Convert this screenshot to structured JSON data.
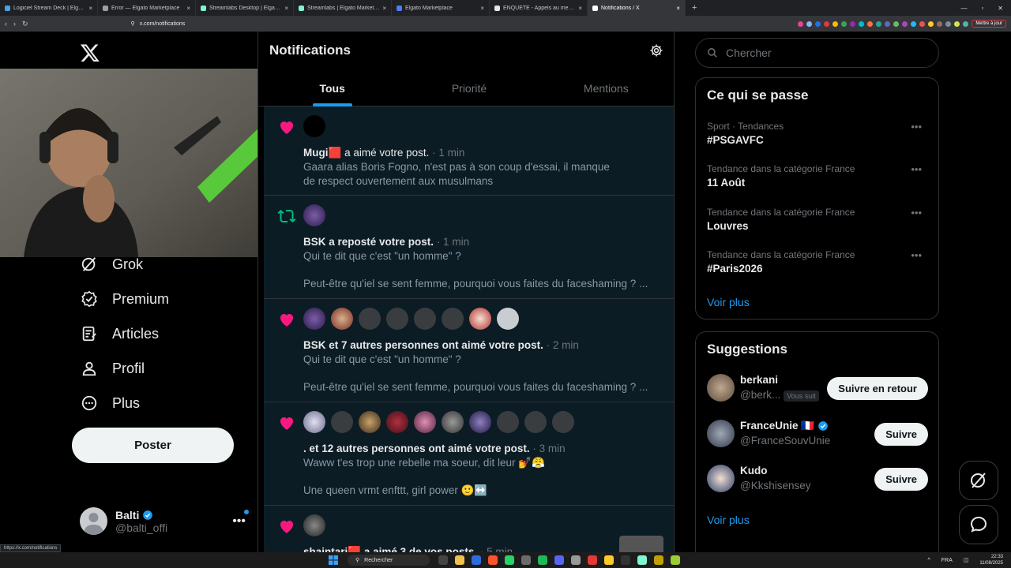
{
  "browser": {
    "tabs": [
      {
        "title": "Logiciel Stream Deck | Elgato",
        "color": "#4aa3df"
      },
      {
        "title": "Error — Elgato Marketplace",
        "color": "#9aa0a6"
      },
      {
        "title": "Streamlabs Desktop | Elgato Marketp",
        "color": "#80f5d2"
      },
      {
        "title": "Streamlabs | Elgato Marketplace",
        "color": "#80f5d2"
      },
      {
        "title": "Elgato Marketplace",
        "color": "#4d7cfe"
      },
      {
        "title": "ENQUÊTE - Appels au meurtre, raton",
        "color": "#e6e6e6"
      },
      {
        "title": "Notifications / X",
        "color": "#ffffff"
      }
    ],
    "new_tab": "+",
    "url": "x.com/notifications",
    "ext_button": "Mettre à jour",
    "status_url": "https://x.com/notifications"
  },
  "nav": {
    "items": [
      {
        "label": "Grok",
        "icon": "grok-icon"
      },
      {
        "label": "Premium",
        "icon": "premium-icon"
      },
      {
        "label": "Articles",
        "icon": "articles-icon"
      },
      {
        "label": "Profil",
        "icon": "profile-icon"
      },
      {
        "label": "Plus",
        "icon": "more-circle-icon"
      }
    ],
    "post_button": "Poster",
    "account": {
      "name": "Balti",
      "handle": "@balti_offi"
    }
  },
  "main": {
    "title": "Notifications",
    "tabs": [
      "Tous",
      "Priorité",
      "Mentions"
    ],
    "notifications": [
      {
        "type": "like",
        "user": "Mugi🟥",
        "action": " a aimé votre post.",
        "time": " · 1 min",
        "body1": "Gaara alias Boris Fogno, n'est pas à son coup d'essai, il manque",
        "body2": "de respect ouvertement aux musulmans",
        "body3": ""
      },
      {
        "type": "repost",
        "user": "BSK",
        "action": " a reposté votre post.",
        "time": " · 1 min",
        "body1": "Qui te dit que c'est \"un homme\" ?",
        "body2": "",
        "body3": "Peut-être qu'iel se sent femme, pourquoi vous faites du faceshaming ? ..."
      },
      {
        "type": "like",
        "user": "BSK",
        "action": " et 7 autres personnes ont aimé votre post.",
        "time": " · 2 min",
        "body1": "Qui te dit que c'est \"un homme\" ?",
        "body2": "",
        "body3": "Peut-être qu'iel se sent femme, pourquoi vous faites du faceshaming ? ..."
      },
      {
        "type": "like",
        "user": ".",
        "action": " et 12 autres personnes ont aimé votre post.",
        "time": " · 3 min",
        "body1": "Waww t'es trop une rebelle ma soeur, dit leur 💅😤",
        "body2": "",
        "body3": "Une queen vrmt enfttt, girl power 🙂↔️"
      },
      {
        "type": "like",
        "user": "shaintari🟥",
        "action": " a aimé 3 de vos posts.",
        "time": " · 5 min",
        "body1": "",
        "body2": "",
        "body3": ""
      }
    ]
  },
  "right": {
    "search_placeholder": "Chercher",
    "trends_title": "Ce qui se passe",
    "trends": [
      {
        "category": "Sport · Tendances",
        "name": "#PSGAVFC"
      },
      {
        "category": "Tendance dans la catégorie France",
        "name": "11 Août"
      },
      {
        "category": "Tendance dans la catégorie France",
        "name": "Louvres"
      },
      {
        "category": "Tendance dans la catégorie France",
        "name": "#Paris2026"
      }
    ],
    "trends_more": "Voir plus",
    "suggestions_title": "Suggestions",
    "suggestions": [
      {
        "name": "berkani",
        "handle": "@berk...",
        "badge": "Vous suit",
        "button": "Suivre en retour"
      },
      {
        "name": "FranceUnie 🇫🇷",
        "handle": "@FranceSouvUnie",
        "badge": "",
        "button": "Suivre"
      },
      {
        "name": "Kudo",
        "handle": "@Kkshisensey",
        "badge": "",
        "button": "Suivre"
      }
    ],
    "suggestions_more": "Voir plus"
  },
  "taskbar": {
    "search": "Rechercher",
    "lang": "FRA",
    "time": "22:33",
    "date": "11/08/2025"
  },
  "colors": {
    "accent": "#1d9bf0",
    "like": "#f91880",
    "repost": "#00ba7c"
  }
}
